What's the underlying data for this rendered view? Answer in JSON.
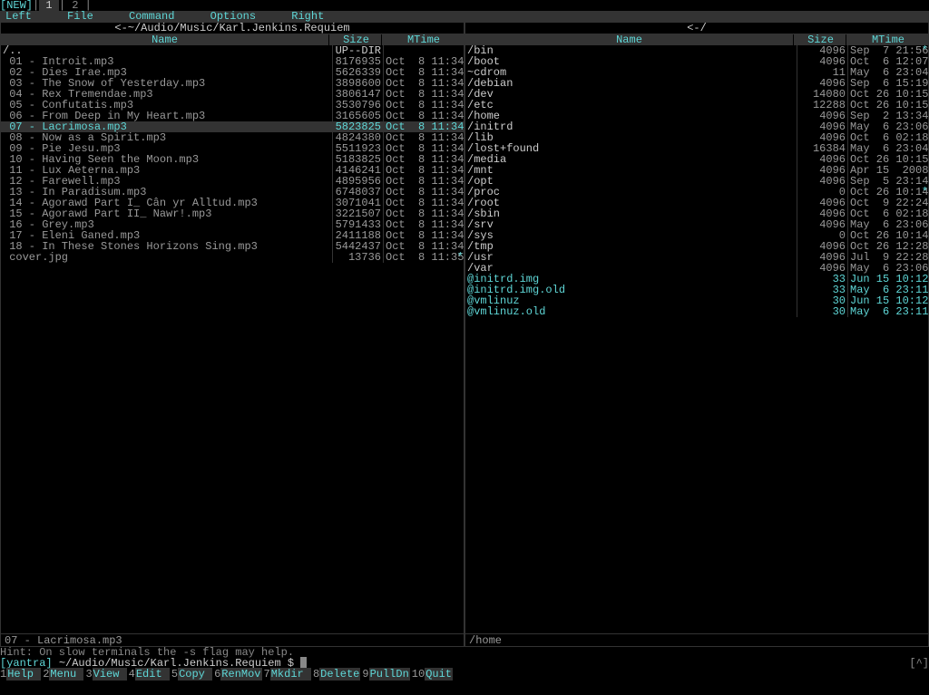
{
  "tabbar": {
    "new": "[NEW]",
    "tab1": " 1 ",
    "sep": "|",
    "tab2": " 2 "
  },
  "menu": {
    "left": "Left",
    "file": "File",
    "command": "Command",
    "options": "Options",
    "right": "Right"
  },
  "left_panel": {
    "title_prefix": "<-",
    "title": "~/Audio/Music/Karl.Jenkins.Requiem",
    "title_suffix": "-.[^]>",
    "headers": {
      "name": "Name",
      "size": "Size",
      "mtime": "MTime"
    },
    "rows": [
      {
        "name": "/..",
        "size": "UP--DIR",
        "mtime": "",
        "cls": "updir"
      },
      {
        "name": " 01 - Introit.mp3",
        "size": "8176935",
        "mtime": "Oct  8 11:34"
      },
      {
        "name": " 02 - Dies Irae.mp3",
        "size": "5626339",
        "mtime": "Oct  8 11:34"
      },
      {
        "name": " 03 - The Snow of Yesterday.mp3",
        "size": "3898600",
        "mtime": "Oct  8 11:34"
      },
      {
        "name": " 04 - Rex Tremendae.mp3",
        "size": "3806147",
        "mtime": "Oct  8 11:34"
      },
      {
        "name": " 05 - Confutatis.mp3",
        "size": "3530796",
        "mtime": "Oct  8 11:34"
      },
      {
        "name": " 06 - From Deep in My Heart.mp3",
        "size": "3165605",
        "mtime": "Oct  8 11:34"
      },
      {
        "name": " 07 - Lacrimosa.mp3",
        "size": "5823825",
        "mtime": "Oct  8 11:34",
        "cls": "sel"
      },
      {
        "name": " 08 - Now as a Spirit.mp3",
        "size": "4824380",
        "mtime": "Oct  8 11:34"
      },
      {
        "name": " 09 - Pie Jesu.mp3",
        "size": "5511923",
        "mtime": "Oct  8 11:34"
      },
      {
        "name": " 10 - Having Seen the Moon.mp3",
        "size": "5183825",
        "mtime": "Oct  8 11:34"
      },
      {
        "name": " 11 - Lux Aeterna.mp3",
        "size": "4146241",
        "mtime": "Oct  8 11:34"
      },
      {
        "name": " 12 - Farewell.mp3",
        "size": "4895956",
        "mtime": "Oct  8 11:34"
      },
      {
        "name": " 13 - In Paradisum.mp3",
        "size": "6748037",
        "mtime": "Oct  8 11:34"
      },
      {
        "name": " 14 - Agorawd Part I_ Cân yr Alltud.mp3",
        "size": "3071041",
        "mtime": "Oct  8 11:34"
      },
      {
        "name": " 15 - Agorawd Part II_ Nawr!.mp3",
        "size": "3221507",
        "mtime": "Oct  8 11:34"
      },
      {
        "name": " 16 - Grey.mp3",
        "size": "5791433",
        "mtime": "Oct  8 11:34"
      },
      {
        "name": " 17 - Eleni Ganed.mp3",
        "size": "2411188",
        "mtime": "Oct  8 11:34"
      },
      {
        "name": " 18 - In These Stones Horizons Sing.mp3",
        "size": "5442437",
        "mtime": "Oct  8 11:34"
      },
      {
        "name": " cover.jpg",
        "size": "13736",
        "mtime": "Oct  8 11:35",
        "mark": "*"
      }
    ],
    "status": " 07 - Lacrimosa.mp3"
  },
  "right_panel": {
    "title_prefix": "<-",
    "title": "/",
    "title_suffix": "-.[^]>",
    "headers": {
      "name": "Name",
      "size": "Size",
      "mtime": "MTime"
    },
    "rows": [
      {
        "name": "/bin",
        "size": "4096",
        "mtime": "Sep  7 21:56",
        "cls": "dir",
        "mark": "*"
      },
      {
        "name": "/boot",
        "size": "4096",
        "mtime": "Oct  6 12:07",
        "cls": "dir"
      },
      {
        "name": "~cdrom",
        "size": "11",
        "mtime": "May  6 23:04",
        "cls": "dir"
      },
      {
        "name": "/debian",
        "size": "4096",
        "mtime": "Sep  6 15:19",
        "cls": "dir"
      },
      {
        "name": "/dev",
        "size": "14080",
        "mtime": "Oct 26 10:15",
        "cls": "dir"
      },
      {
        "name": "/etc",
        "size": "12288",
        "mtime": "Oct 26 10:15",
        "cls": "dir"
      },
      {
        "name": "/home",
        "size": "4096",
        "mtime": "Sep  2 13:34",
        "cls": "dir"
      },
      {
        "name": "/initrd",
        "size": "4096",
        "mtime": "May  6 23:06",
        "cls": "dir"
      },
      {
        "name": "/lib",
        "size": "4096",
        "mtime": "Oct  6 02:18",
        "cls": "dir"
      },
      {
        "name": "/lost+found",
        "size": "16384",
        "mtime": "May  6 23:04",
        "cls": "dir"
      },
      {
        "name": "/media",
        "size": "4096",
        "mtime": "Oct 26 10:15",
        "cls": "dir"
      },
      {
        "name": "/mnt",
        "size": "4096",
        "mtime": "Apr 15  2008",
        "cls": "dir"
      },
      {
        "name": "/opt",
        "size": "4096",
        "mtime": "Sep  5 23:14",
        "cls": "dir"
      },
      {
        "name": "/proc",
        "size": "0",
        "mtime": "Oct 26 10:14",
        "cls": "dir",
        "mark": "*"
      },
      {
        "name": "/root",
        "size": "4096",
        "mtime": "Oct  9 22:24",
        "cls": "dir"
      },
      {
        "name": "/sbin",
        "size": "4096",
        "mtime": "Oct  6 02:18",
        "cls": "dir"
      },
      {
        "name": "/srv",
        "size": "4096",
        "mtime": "May  6 23:06",
        "cls": "dir"
      },
      {
        "name": "/sys",
        "size": "0",
        "mtime": "Oct 26 10:14",
        "cls": "dir"
      },
      {
        "name": "/tmp",
        "size": "4096",
        "mtime": "Oct 26 12:28",
        "cls": "dir"
      },
      {
        "name": "/usr",
        "size": "4096",
        "mtime": "Jul  9 22:28",
        "cls": "dir"
      },
      {
        "name": "/var",
        "size": "4096",
        "mtime": "May  6 23:06",
        "cls": "dir"
      },
      {
        "name": "@initrd.img",
        "size": "33",
        "mtime": "Jun 15 10:12",
        "cls": "sym"
      },
      {
        "name": "@initrd.img.old",
        "size": "33",
        "mtime": "May  6 23:11",
        "cls": "sym"
      },
      {
        "name": "@vmlinuz",
        "size": "30",
        "mtime": "Jun 15 10:12",
        "cls": "sym"
      },
      {
        "name": "@vmlinuz.old",
        "size": "30",
        "mtime": "May  6 23:11",
        "cls": "sym"
      }
    ],
    "status": " /home"
  },
  "hint": "Hint: On slow terminals the -s flag may help.",
  "prompt": {
    "host": "[yantra] ",
    "path": "~/Audio/Music/Karl.Jenkins.Requiem $ ",
    "right": "[^]"
  },
  "fkeys": [
    {
      "n": "1",
      "l": "Help  "
    },
    {
      "n": "2",
      "l": "Menu  "
    },
    {
      "n": "3",
      "l": "View  "
    },
    {
      "n": "4",
      "l": "Edit  "
    },
    {
      "n": "5",
      "l": "Copy  "
    },
    {
      "n": "6",
      "l": "RenMov"
    },
    {
      "n": "7",
      "l": "Mkdir "
    },
    {
      "n": "8",
      "l": "Delete"
    },
    {
      "n": "9",
      "l": "PullDn"
    },
    {
      "n": "10",
      "l": "Quit  "
    }
  ]
}
